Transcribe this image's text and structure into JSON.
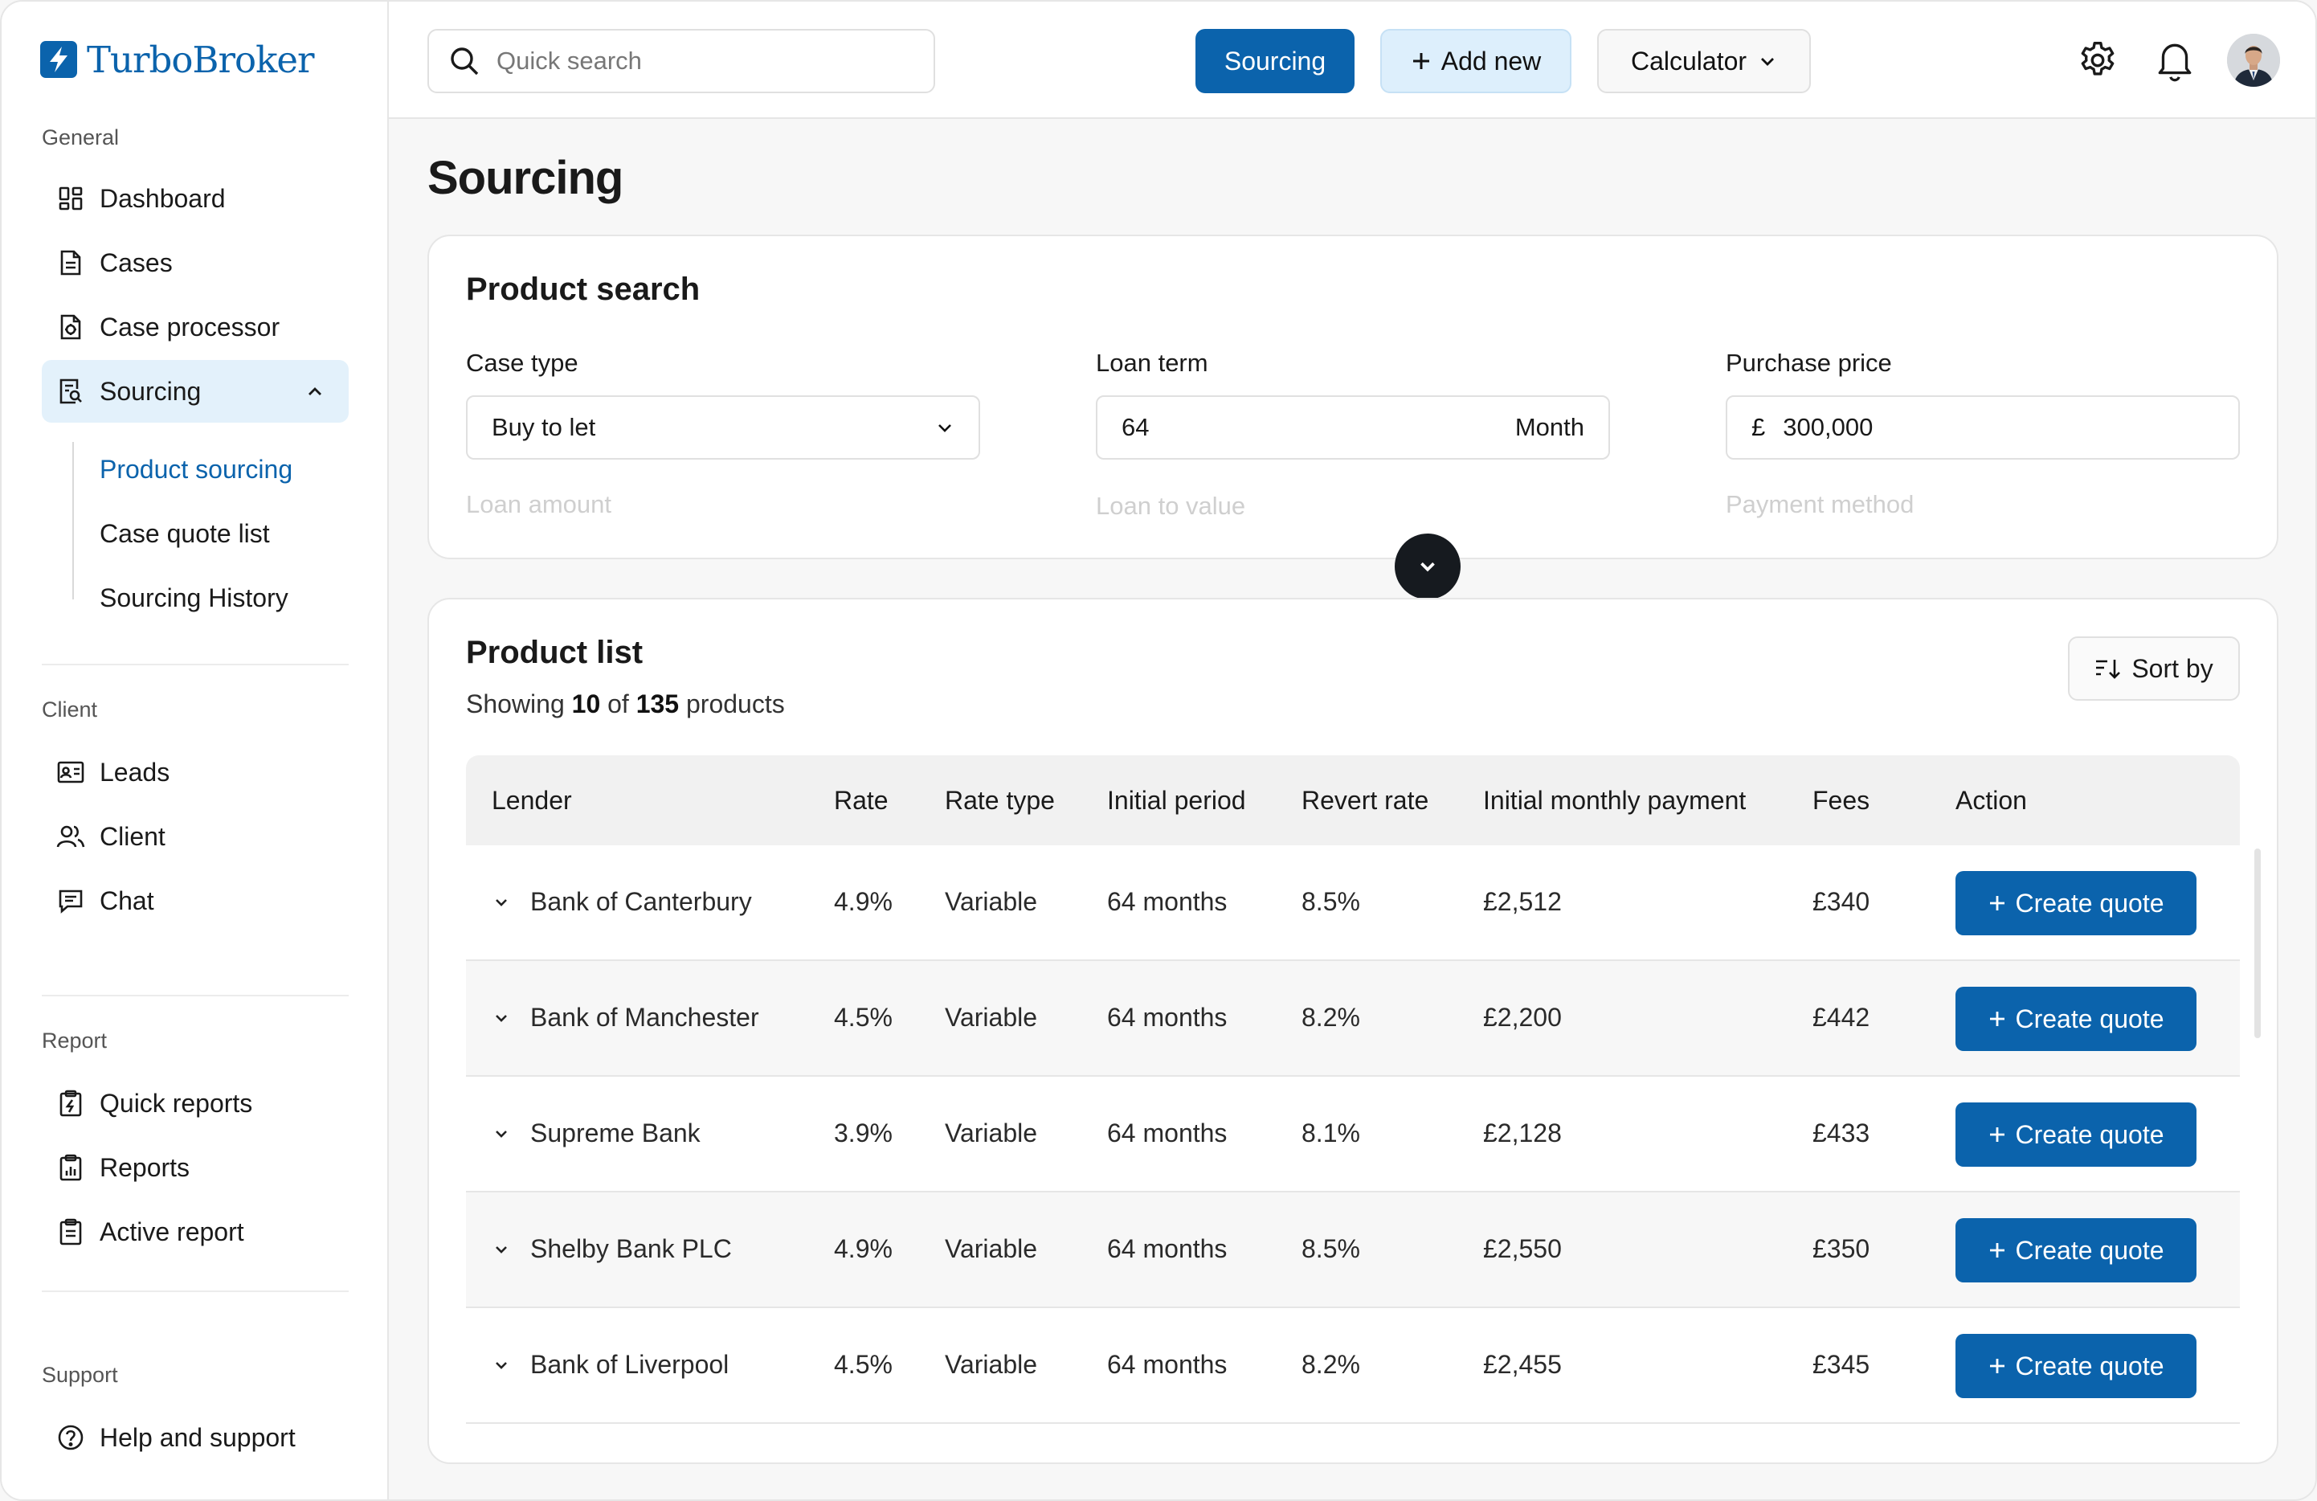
{
  "app": {
    "brand": "TurboBroker",
    "accent": "#0b63ac",
    "accent_light": "#e3f1fb"
  },
  "sidebar": {
    "general_label": "General",
    "general": [
      {
        "label": "Dashboard",
        "icon": "dashboard-icon"
      },
      {
        "label": "Cases",
        "icon": "document-icon"
      },
      {
        "label": "Case processor",
        "icon": "case-processor-icon"
      },
      {
        "label": "Sourcing",
        "icon": "sourcing-icon",
        "active": true,
        "expanded": true
      }
    ],
    "sourcing_children": [
      {
        "label": "Product sourcing",
        "current": true
      },
      {
        "label": "Case quote list"
      },
      {
        "label": "Sourcing History"
      }
    ],
    "client_label": "Client",
    "client": [
      {
        "label": "Leads",
        "icon": "contact-card-icon"
      },
      {
        "label": "Client",
        "icon": "users-icon"
      },
      {
        "label": "Chat",
        "icon": "chat-icon"
      }
    ],
    "report_label": "Report",
    "report": [
      {
        "label": "Quick reports",
        "icon": "quick-report-icon"
      },
      {
        "label": "Reports",
        "icon": "report-chart-icon"
      },
      {
        "label": "Active report",
        "icon": "clipboard-icon"
      }
    ],
    "support_label": "Support",
    "support": [
      {
        "label": "Help and support",
        "icon": "help-icon"
      }
    ]
  },
  "topbar": {
    "search_placeholder": "Quick search",
    "sourcing_button": "Sourcing",
    "add_new_button": "Add new",
    "calculator_button": "Calculator"
  },
  "page": {
    "title": "Sourcing"
  },
  "product_search": {
    "title": "Product search",
    "case_type": {
      "label": "Case type",
      "value": "Buy to let"
    },
    "loan_term": {
      "label": "Loan term",
      "value": "64",
      "unit": "Month"
    },
    "purchase_price": {
      "label": "Purchase price",
      "currency": "£",
      "value": "300,000"
    },
    "collapsed_fields": [
      "Loan amount",
      "Loan to value",
      "Payment method"
    ]
  },
  "product_list": {
    "title": "Product list",
    "showing_prefix": "Showing",
    "shown": "10",
    "of": "of",
    "total": "135",
    "suffix": "products",
    "sort_label": "Sort by",
    "columns": [
      "Lender",
      "Rate",
      "Rate type",
      "Initial period",
      "Revert rate",
      "Initial monthly payment",
      "Fees",
      "Action"
    ],
    "action_label": "Create quote",
    "rows": [
      {
        "lender": "Bank of Canterbury",
        "rate": "4.9%",
        "rate_type": "Variable",
        "initial_period": "64 months",
        "revert_rate": "8.5%",
        "payment": "£2,512",
        "fees": "£340"
      },
      {
        "lender": "Bank of Manchester",
        "rate": "4.5%",
        "rate_type": "Variable",
        "initial_period": "64 months",
        "revert_rate": "8.2%",
        "payment": "£2,200",
        "fees": "£442"
      },
      {
        "lender": "Supreme Bank",
        "rate": "3.9%",
        "rate_type": "Variable",
        "initial_period": "64 months",
        "revert_rate": "8.1%",
        "payment": "£2,128",
        "fees": "£433"
      },
      {
        "lender": "Shelby Bank PLC",
        "rate": "4.9%",
        "rate_type": "Variable",
        "initial_period": "64 months",
        "revert_rate": "8.5%",
        "payment": "£2,550",
        "fees": "£350"
      },
      {
        "lender": "Bank of Liverpool",
        "rate": "4.5%",
        "rate_type": "Variable",
        "initial_period": "64 months",
        "revert_rate": "8.2%",
        "payment": "£2,455",
        "fees": "£345"
      }
    ]
  }
}
